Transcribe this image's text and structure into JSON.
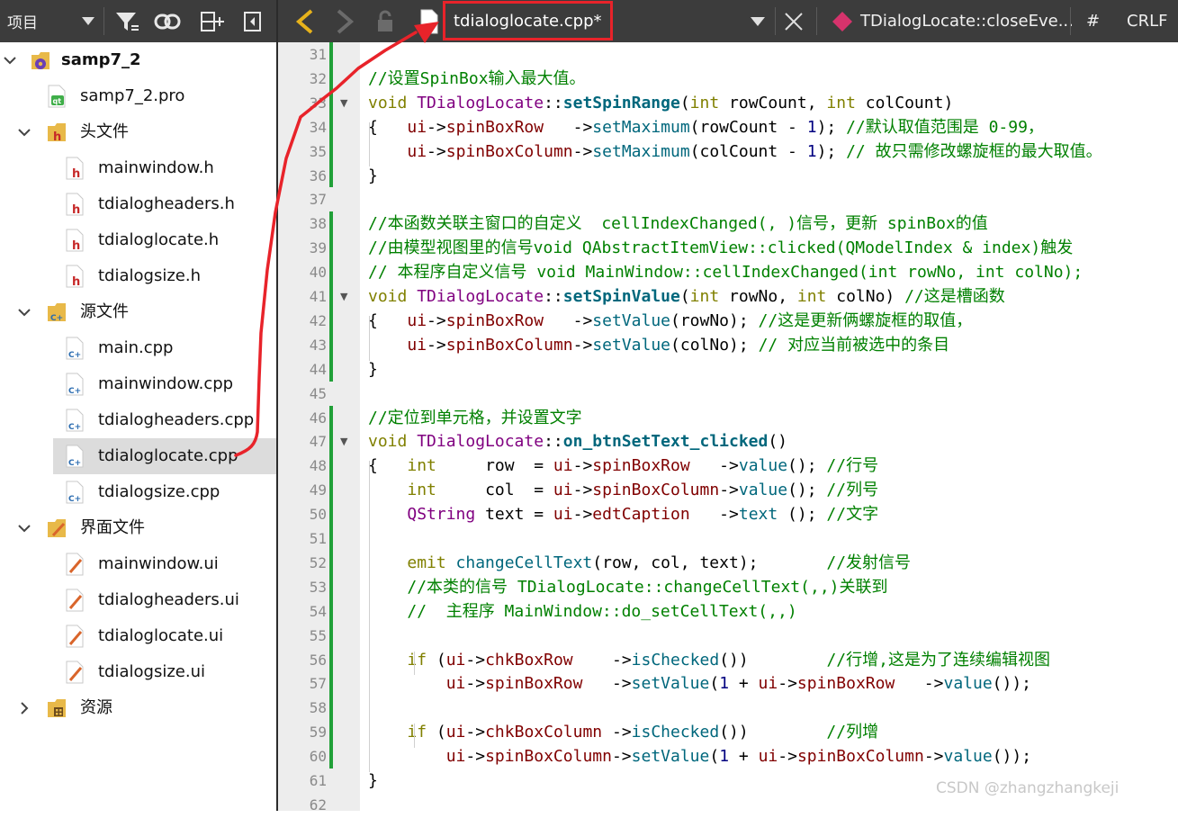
{
  "project_panel": {
    "title": "项目",
    "icons": [
      "filter-icon",
      "link-icon",
      "split-add-icon",
      "close-sidebar-icon"
    ],
    "tree": [
      {
        "label": "samp7_2",
        "level": 0,
        "arrow": "down",
        "icon": "project-gear-icon",
        "bold": true
      },
      {
        "label": "samp7_2.pro",
        "level": 1,
        "arrow": "",
        "icon": "qt-pro-file-icon"
      },
      {
        "label": "头文件",
        "level": 1,
        "arrow": "down",
        "icon": "header-folder-icon"
      },
      {
        "label": "mainwindow.h",
        "level": 2,
        "arrow": "",
        "icon": "header-file-icon"
      },
      {
        "label": "tdialogheaders.h",
        "level": 2,
        "arrow": "",
        "icon": "header-file-icon"
      },
      {
        "label": "tdialoglocate.h",
        "level": 2,
        "arrow": "",
        "icon": "header-file-icon"
      },
      {
        "label": "tdialogsize.h",
        "level": 2,
        "arrow": "",
        "icon": "header-file-icon"
      },
      {
        "label": "源文件",
        "level": 1,
        "arrow": "down",
        "icon": "source-folder-icon"
      },
      {
        "label": "main.cpp",
        "level": 2,
        "arrow": "",
        "icon": "cpp-file-icon"
      },
      {
        "label": "mainwindow.cpp",
        "level": 2,
        "arrow": "",
        "icon": "cpp-file-icon"
      },
      {
        "label": "tdialogheaders.cpp",
        "level": 2,
        "arrow": "",
        "icon": "cpp-file-icon"
      },
      {
        "label": "tdialoglocate.cpp",
        "level": 2,
        "arrow": "",
        "icon": "cpp-file-icon",
        "selected": true
      },
      {
        "label": "tdialogsize.cpp",
        "level": 2,
        "arrow": "",
        "icon": "cpp-file-icon"
      },
      {
        "label": "界面文件",
        "level": 1,
        "arrow": "down",
        "icon": "forms-folder-icon"
      },
      {
        "label": "mainwindow.ui",
        "level": 2,
        "arrow": "",
        "icon": "ui-file-icon"
      },
      {
        "label": "tdialogheaders.ui",
        "level": 2,
        "arrow": "",
        "icon": "ui-file-icon"
      },
      {
        "label": "tdialoglocate.ui",
        "level": 2,
        "arrow": "",
        "icon": "ui-file-icon"
      },
      {
        "label": "tdialogsize.ui",
        "level": 2,
        "arrow": "",
        "icon": "ui-file-icon"
      },
      {
        "label": "资源",
        "level": 1,
        "arrow": "right",
        "icon": "resources-folder-icon"
      }
    ]
  },
  "editor_toolbar": {
    "file_tab": "tdialoglocate.cpp*",
    "function_selector": "TDialogLocate::closeEve...",
    "hash": "#",
    "line_ending": "CRLF"
  },
  "editor": {
    "lines": [
      {
        "n": "31",
        "t": []
      },
      {
        "n": "32",
        "t": [
          [
            "cm",
            "//设置SpinBox输入最大值。"
          ]
        ]
      },
      {
        "n": "33",
        "t": [
          [
            "kw",
            "void "
          ],
          [
            "ty",
            "TDialogLocate"
          ],
          [
            "",
            "::"
          ],
          [
            "fn",
            "setSpinRange"
          ],
          [
            "",
            "("
          ],
          [
            "kw",
            "int "
          ],
          [
            "",
            "rowCount, "
          ],
          [
            "kw",
            "int "
          ],
          [
            "",
            "colCount)"
          ]
        ],
        "fold": true
      },
      {
        "n": "34",
        "t": [
          [
            "",
            "{   "
          ],
          [
            "mb",
            "ui"
          ],
          [
            "",
            "->"
          ],
          [
            "mb",
            "spinBoxRow"
          ],
          [
            "",
            "   ->"
          ],
          [
            "mt",
            "setMaximum"
          ],
          [
            "",
            "(rowCount - "
          ],
          [
            "nm",
            "1"
          ],
          [
            "",
            "); "
          ],
          [
            "cm",
            "//默认取值范围是 0-99，"
          ]
        ]
      },
      {
        "n": "35",
        "t": [
          [
            "",
            "    "
          ],
          [
            "mb",
            "ui"
          ],
          [
            "",
            "->"
          ],
          [
            "mb",
            "spinBoxColumn"
          ],
          [
            "",
            "->"
          ],
          [
            "mt",
            "setMaximum"
          ],
          [
            "",
            "(colCount - "
          ],
          [
            "nm",
            "1"
          ],
          [
            "",
            "); "
          ],
          [
            "cm",
            "// 故只需修改螺旋框的最大取值。"
          ]
        ]
      },
      {
        "n": "36",
        "t": [
          [
            "",
            "}"
          ]
        ]
      },
      {
        "n": "37",
        "t": []
      },
      {
        "n": "38",
        "t": [
          [
            "cm",
            "//本函数关联主窗口的自定义  cellIndexChanged(, )信号，更新 spinBox的值"
          ]
        ]
      },
      {
        "n": "39",
        "t": [
          [
            "cm",
            "//由模型视图里的信号void QAbstractItemView::clicked(QModelIndex & index)触发"
          ]
        ]
      },
      {
        "n": "40",
        "t": [
          [
            "cm",
            "// 本程序自定义信号 void MainWindow::cellIndexChanged(int rowNo, int colNo);"
          ]
        ]
      },
      {
        "n": "41",
        "t": [
          [
            "kw",
            "void "
          ],
          [
            "ty",
            "TDialogLocate"
          ],
          [
            "",
            "::"
          ],
          [
            "fn",
            "setSpinValue"
          ],
          [
            "",
            "("
          ],
          [
            "kw",
            "int "
          ],
          [
            "",
            "rowNo, "
          ],
          [
            "kw",
            "int "
          ],
          [
            "",
            "colNo) "
          ],
          [
            "cm",
            "//这是槽函数"
          ]
        ],
        "fold": true
      },
      {
        "n": "42",
        "t": [
          [
            "",
            "{   "
          ],
          [
            "mb",
            "ui"
          ],
          [
            "",
            "->"
          ],
          [
            "mb",
            "spinBoxRow"
          ],
          [
            "",
            "   ->"
          ],
          [
            "mt",
            "setValue"
          ],
          [
            "",
            "(rowNo); "
          ],
          [
            "cm",
            "//这是更新俩螺旋框的取值，"
          ]
        ]
      },
      {
        "n": "43",
        "t": [
          [
            "",
            "    "
          ],
          [
            "mb",
            "ui"
          ],
          [
            "",
            "->"
          ],
          [
            "mb",
            "spinBoxColumn"
          ],
          [
            "",
            "->"
          ],
          [
            "mt",
            "setValue"
          ],
          [
            "",
            "(colNo); "
          ],
          [
            "cm",
            "// 对应当前被选中的条目"
          ]
        ]
      },
      {
        "n": "44",
        "t": [
          [
            "",
            "}"
          ]
        ]
      },
      {
        "n": "45",
        "t": []
      },
      {
        "n": "46",
        "t": [
          [
            "cm",
            "//定位到单元格，并设置文字"
          ]
        ]
      },
      {
        "n": "47",
        "t": [
          [
            "kw",
            "void "
          ],
          [
            "ty",
            "TDialogLocate"
          ],
          [
            "",
            "::"
          ],
          [
            "fn",
            "on_btnSetText_clicked"
          ],
          [
            "",
            "()"
          ]
        ],
        "fold": true
      },
      {
        "n": "48",
        "t": [
          [
            "",
            "{   "
          ],
          [
            "kw",
            "int     "
          ],
          [
            "",
            "row  = "
          ],
          [
            "mb",
            "ui"
          ],
          [
            "",
            "->"
          ],
          [
            "mb",
            "spinBoxRow"
          ],
          [
            "",
            "   ->"
          ],
          [
            "mt",
            "value"
          ],
          [
            "",
            "(); "
          ],
          [
            "cm",
            "//行号"
          ]
        ]
      },
      {
        "n": "49",
        "t": [
          [
            "",
            "    "
          ],
          [
            "kw",
            "int     "
          ],
          [
            "",
            "col  = "
          ],
          [
            "mb",
            "ui"
          ],
          [
            "",
            "->"
          ],
          [
            "mb",
            "spinBoxColumn"
          ],
          [
            "",
            "->"
          ],
          [
            "mt",
            "value"
          ],
          [
            "",
            "(); "
          ],
          [
            "cm",
            "//列号"
          ]
        ]
      },
      {
        "n": "50",
        "t": [
          [
            "",
            "    "
          ],
          [
            "ty",
            "QString "
          ],
          [
            "",
            "text = "
          ],
          [
            "mb",
            "ui"
          ],
          [
            "",
            "->"
          ],
          [
            "mb",
            "edtCaption"
          ],
          [
            "",
            "   ->"
          ],
          [
            "mt",
            "text "
          ],
          [
            "",
            "(); "
          ],
          [
            "cm",
            "//文字"
          ]
        ]
      },
      {
        "n": "51",
        "t": []
      },
      {
        "n": "52",
        "t": [
          [
            "",
            "    "
          ],
          [
            "kw",
            "emit "
          ],
          [
            "mt",
            "changeCellText"
          ],
          [
            "",
            "(row, col, text);       "
          ],
          [
            "cm",
            "//发射信号"
          ]
        ]
      },
      {
        "n": "53",
        "t": [
          [
            "",
            "    "
          ],
          [
            "cm",
            "//本类的信号 TDialogLocate::changeCellText(,,)关联到"
          ]
        ]
      },
      {
        "n": "54",
        "t": [
          [
            "",
            "    "
          ],
          [
            "cm",
            "//  主程序 MainWindow::do_setCellText(,,)"
          ]
        ]
      },
      {
        "n": "55",
        "t": []
      },
      {
        "n": "56",
        "t": [
          [
            "",
            "    "
          ],
          [
            "kw",
            "if "
          ],
          [
            "",
            "("
          ],
          [
            "mb",
            "ui"
          ],
          [
            "",
            "->"
          ],
          [
            "mb",
            "chkBoxRow"
          ],
          [
            "",
            "    ->"
          ],
          [
            "mt",
            "isChecked"
          ],
          [
            "",
            "())        "
          ],
          [
            "cm",
            "//行增,这是为了连续编辑视图"
          ]
        ]
      },
      {
        "n": "57",
        "t": [
          [
            "",
            "        "
          ],
          [
            "mb",
            "ui"
          ],
          [
            "",
            "->"
          ],
          [
            "mb",
            "spinBoxRow"
          ],
          [
            "",
            "   ->"
          ],
          [
            "mt",
            "setValue"
          ],
          [
            "",
            "("
          ],
          [
            "nm",
            "1"
          ],
          [
            "",
            " + "
          ],
          [
            "mb",
            "ui"
          ],
          [
            "",
            "->"
          ],
          [
            "mb",
            "spinBoxRow"
          ],
          [
            "",
            "   ->"
          ],
          [
            "mt",
            "value"
          ],
          [
            "",
            "());"
          ]
        ]
      },
      {
        "n": "58",
        "t": []
      },
      {
        "n": "59",
        "t": [
          [
            "",
            "    "
          ],
          [
            "kw",
            "if "
          ],
          [
            "",
            "("
          ],
          [
            "mb",
            "ui"
          ],
          [
            "",
            "->"
          ],
          [
            "mb",
            "chkBoxColumn"
          ],
          [
            "",
            " ->"
          ],
          [
            "mt",
            "isChecked"
          ],
          [
            "",
            "())        "
          ],
          [
            "cm",
            "//列增"
          ]
        ]
      },
      {
        "n": "60",
        "t": [
          [
            "",
            "        "
          ],
          [
            "mb",
            "ui"
          ],
          [
            "",
            "->"
          ],
          [
            "mb",
            "spinBoxColumn"
          ],
          [
            "",
            "->"
          ],
          [
            "mt",
            "setValue"
          ],
          [
            "",
            "("
          ],
          [
            "nm",
            "1"
          ],
          [
            "",
            " + "
          ],
          [
            "mb",
            "ui"
          ],
          [
            "",
            "->"
          ],
          [
            "mb",
            "spinBoxColumn"
          ],
          [
            "",
            "->"
          ],
          [
            "mt",
            "value"
          ],
          [
            "",
            "());"
          ]
        ]
      },
      {
        "n": "61",
        "t": [
          [
            "",
            "}"
          ]
        ]
      },
      {
        "n": "62",
        "t": []
      }
    ]
  },
  "watermark": "CSDN @zhangzhangkeji",
  "colors": {
    "comment": "#008000",
    "keyword": "#808000",
    "type": "#800080",
    "function": "#00677c",
    "member": "#800000",
    "number": "#000080",
    "annotation": "#e8232a"
  }
}
